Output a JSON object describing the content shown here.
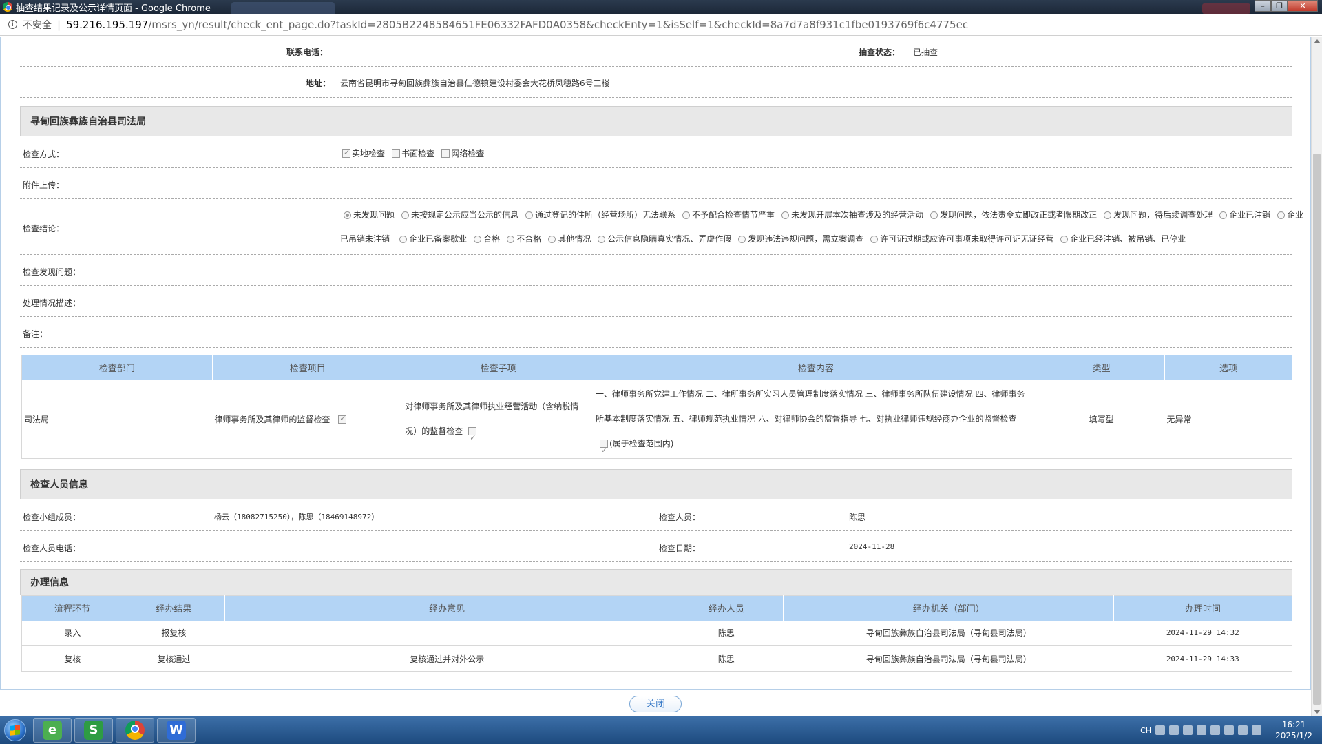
{
  "window": {
    "title": "抽查结果记录及公示详情页面 - Google Chrome"
  },
  "address": {
    "insecure_label": "不安全",
    "host": "59.216.195.197",
    "path": "/msrs_yn/result/check_ent_page.do?taskId=2805B2248584651FE06332FAFD0A0358&checkEnty=1&isSelf=1&checkId=8a7d7a8f931c1fbe0193769f6c4775ec"
  },
  "basic": {
    "phone_label": "联系电话：",
    "phone_value": "",
    "status_label": "抽查状态：",
    "status_value": "已抽查",
    "address_label": "地址：",
    "address_value": "云南省昆明市寻甸回族彝族自治县仁德镇建设村委会大花桥凤穗路6号三楼"
  },
  "dept_section": {
    "title": "寻甸回族彝族自治县司法局",
    "method_label": "检查方式：",
    "methods": [
      {
        "label": "实地检查",
        "checked": true
      },
      {
        "label": "书面检查",
        "checked": false
      },
      {
        "label": "网络检查",
        "checked": false
      }
    ],
    "attachment_label": "附件上传：",
    "conclusion_label": "检查结论：",
    "conclusions_line1": [
      {
        "label": "未发现问题",
        "checked": true
      },
      {
        "label": "未按规定公示应当公示的信息",
        "checked": false
      },
      {
        "label": "通过登记的住所（经营场所）无法联系",
        "checked": false
      },
      {
        "label": "不予配合检查情节严重",
        "checked": false
      },
      {
        "label": "未发现开展本次抽查涉及的经营活动",
        "checked": false
      },
      {
        "label": "发现问题，依法责令立即改正或者限期改正",
        "checked": false
      },
      {
        "label": "发现问题，待后续调查处理",
        "checked": false
      },
      {
        "label": "企业已注销",
        "checked": false
      },
      {
        "label": "企业",
        "checked": false
      }
    ],
    "conclusions_line2_lead": "已吊销未注销",
    "conclusions_line2": [
      {
        "label": "企业已备案歇业",
        "checked": false
      },
      {
        "label": "合格",
        "checked": false
      },
      {
        "label": "不合格",
        "checked": false
      },
      {
        "label": "其他情况",
        "checked": false
      },
      {
        "label": "公示信息隐瞒真实情况、弄虚作假",
        "checked": false
      },
      {
        "label": "发现违法违规问题，需立案调查",
        "checked": false
      },
      {
        "label": "许可证过期或应许可事项未取得许可证无证经营",
        "checked": false
      },
      {
        "label": "企业已经注销、被吊销、已停业",
        "checked": false
      }
    ],
    "problems_label": "检查发现问题：",
    "handling_label": "处理情况描述：",
    "remark_label": "备注："
  },
  "check_table": {
    "headers": [
      "检查部门",
      "检查项目",
      "检查子项",
      "检查内容",
      "类型",
      "选项"
    ],
    "row": {
      "dept": "司法局",
      "item": "律师事务所及其律师的监督检查",
      "subitem_line1": "对律师事务所及其律师执业经营活动（含纳税情",
      "subitem_line2": "况）的监督检查",
      "content_line1": "一、律师事务所党建工作情况 二、律所事务所实习人员管理制度落实情况 三、律师事务所队伍建设情况 四、律师事务",
      "content_line2": "所基本制度落实情况 五、律师规范执业情况 六、对律师协会的监督指导 七、对执业律师违规经商办企业的监督检查",
      "content_line3": "(属于检查范围内)",
      "type": "填写型",
      "option": "无异常"
    }
  },
  "inspector_section": {
    "title": "检查人员信息",
    "team_label": "检查小组成员：",
    "team_value": "杨云（18082715250），陈思（18469148972）",
    "inspector_label": "检查人员：",
    "inspector_value": "陈思",
    "phone_label": "检查人员电话：",
    "phone_value": "",
    "date_label": "检查日期：",
    "date_value": "2024-11-28"
  },
  "process_section": {
    "title": "办理信息",
    "headers": [
      "流程环节",
      "经办结果",
      "经办意见",
      "经办人员",
      "经办机关（部门）",
      "办理时间"
    ],
    "rows": [
      [
        "录入",
        "报复核",
        "",
        "陈思",
        "寻甸回族彝族自治县司法局（寻甸县司法局）",
        "2024-11-29 14:32"
      ],
      [
        "复核",
        "复核通过",
        "复核通过并对外公示",
        "陈思",
        "寻甸回族彝族自治县司法局（寻甸县司法局）",
        "2024-11-29 14:33"
      ]
    ]
  },
  "close_button": "关闭",
  "taskbar": {
    "apps": [
      {
        "icon": "browser-360-icon",
        "color": "#4caf50",
        "glyph": "e"
      },
      {
        "icon": "wps-sheet-icon",
        "color": "#2e9c43",
        "glyph": "S"
      },
      {
        "icon": "chrome-icon",
        "color": "#db4437",
        "glyph": ""
      },
      {
        "icon": "wps-writer-icon",
        "color": "#2f6cd6",
        "glyph": "W"
      }
    ],
    "lang": "CH",
    "time": "16:21",
    "date": "2025/1/2"
  }
}
